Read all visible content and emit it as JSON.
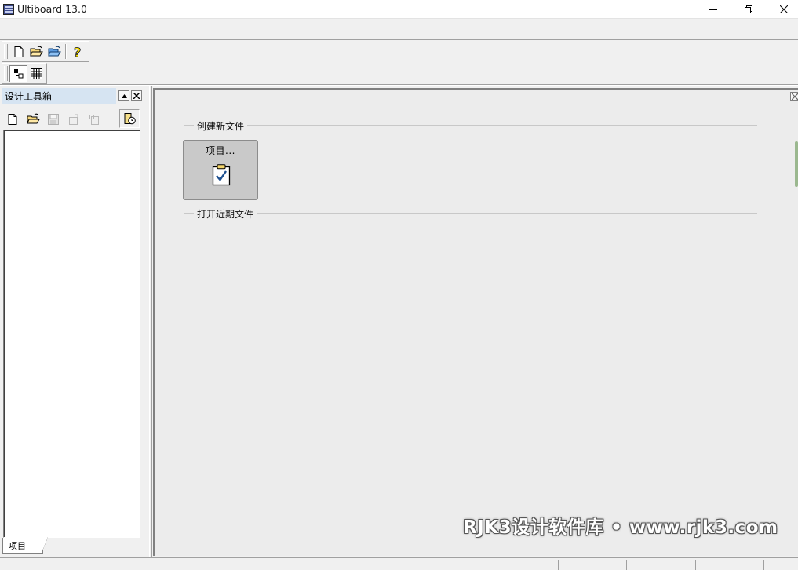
{
  "window": {
    "title": "Ultiboard 13.0"
  },
  "icons": {
    "app": "ultiboard-app-icon",
    "minimize": "minimize-icon",
    "maximize": "restore-icon",
    "close": "close-icon",
    "new": "new-document-icon",
    "open": "open-folder-icon",
    "open_samples": "open-samples-folder-icon",
    "help": "help-question-icon",
    "toggle_design_toolbox": "design-toolbox-icon",
    "toggle_spreadsheet": "spreadsheet-icon",
    "save": "save-icon",
    "close_doc": "close-document-icon",
    "print": "print-icon",
    "recent": "recent-projects-icon",
    "project_tile": "clipboard-check-icon"
  },
  "left_panel": {
    "title": "设计工具箱",
    "tab_label": "项目"
  },
  "start_page": {
    "new_section_label": "创建新文件",
    "project_tile_label": "项目...",
    "recent_section_label": "打开近期文件"
  },
  "watermark": {
    "text": "RJK3设计软件库 • www.rjk3.com"
  },
  "colors": {
    "panel_header_bg": "#d6e4f2",
    "tile_bg": "#c9c9c9",
    "main_bg": "#ececec"
  }
}
